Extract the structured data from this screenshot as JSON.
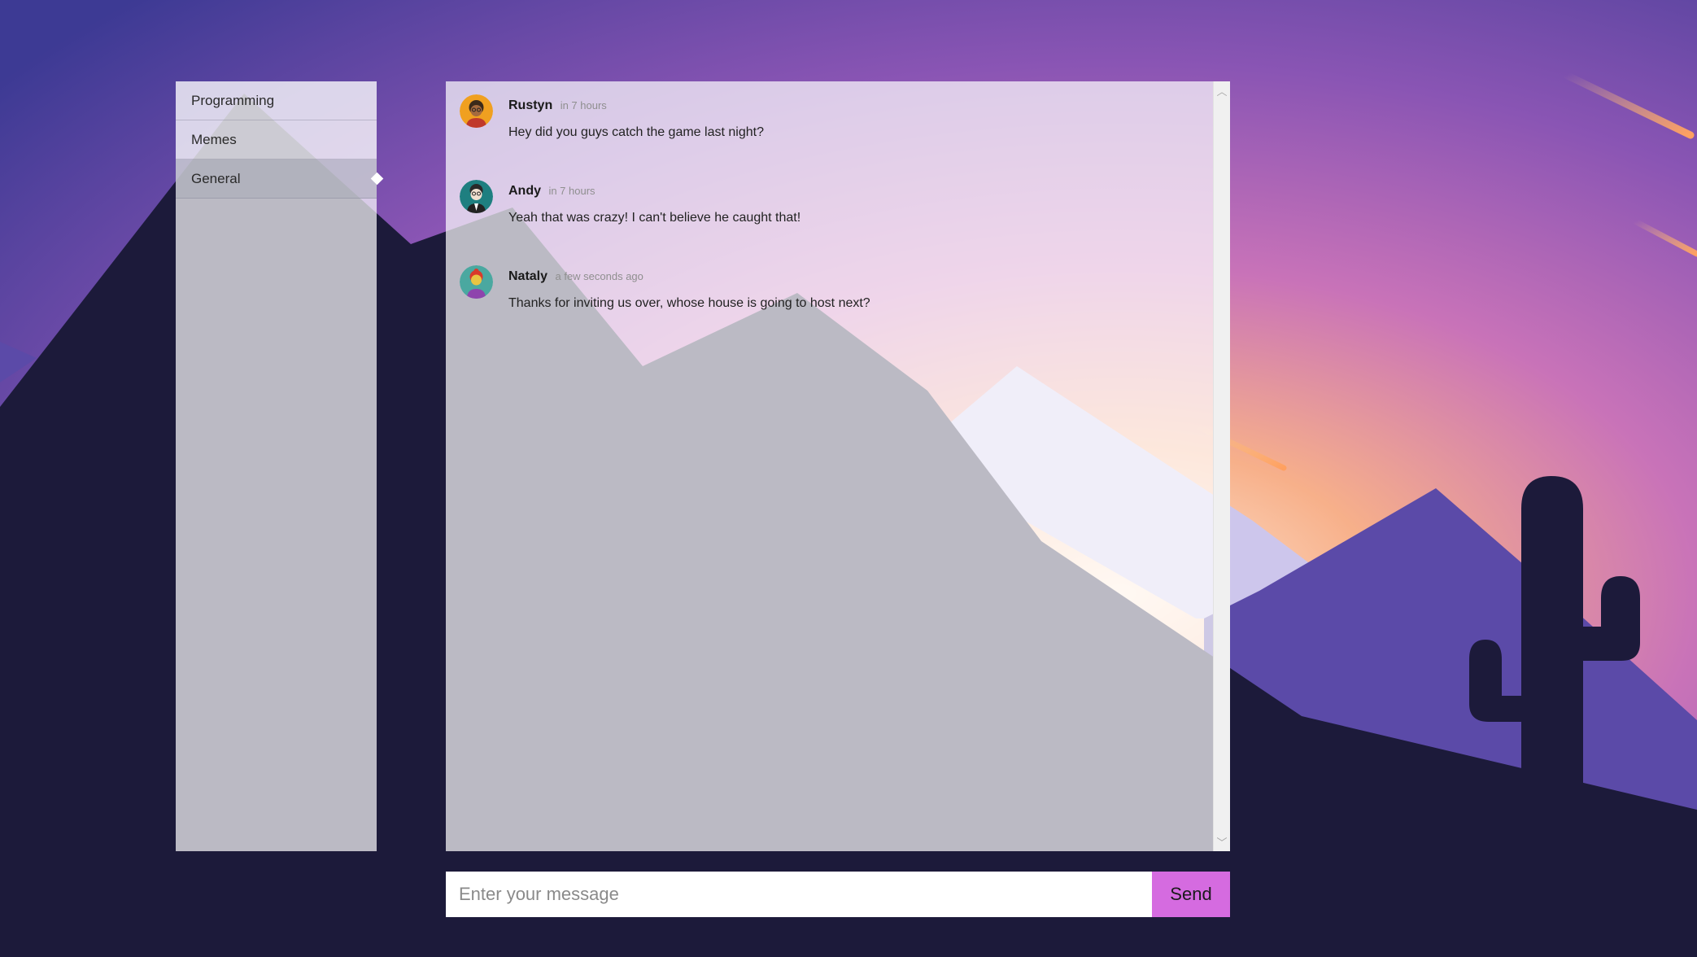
{
  "channels": [
    {
      "label": "Programming",
      "active": false
    },
    {
      "label": "Memes",
      "active": false
    },
    {
      "label": "General",
      "active": true
    }
  ],
  "messages": [
    {
      "author": "Rustyn",
      "time": "in 7 hours",
      "text": "Hey did you guys catch the game last night?",
      "avatar_color": "#f0a020"
    },
    {
      "author": "Andy",
      "time": "in 7 hours",
      "text": "Yeah that was crazy! I can't believe he caught that!",
      "avatar_color": "#1e7f80"
    },
    {
      "author": "Nataly",
      "time": "a few seconds ago",
      "text": "Thanks for inviting us over, whose house is going to host next?",
      "avatar_color": "#4aa8a0"
    }
  ],
  "composer": {
    "placeholder": "Enter your message",
    "send_label": "Send"
  },
  "colors": {
    "send_button": "#d56be0",
    "sky_top": "#7a4fb0",
    "sunset": "#f5a47a",
    "mountains": "#5b4aa8",
    "ground": "#1c1a3a"
  }
}
